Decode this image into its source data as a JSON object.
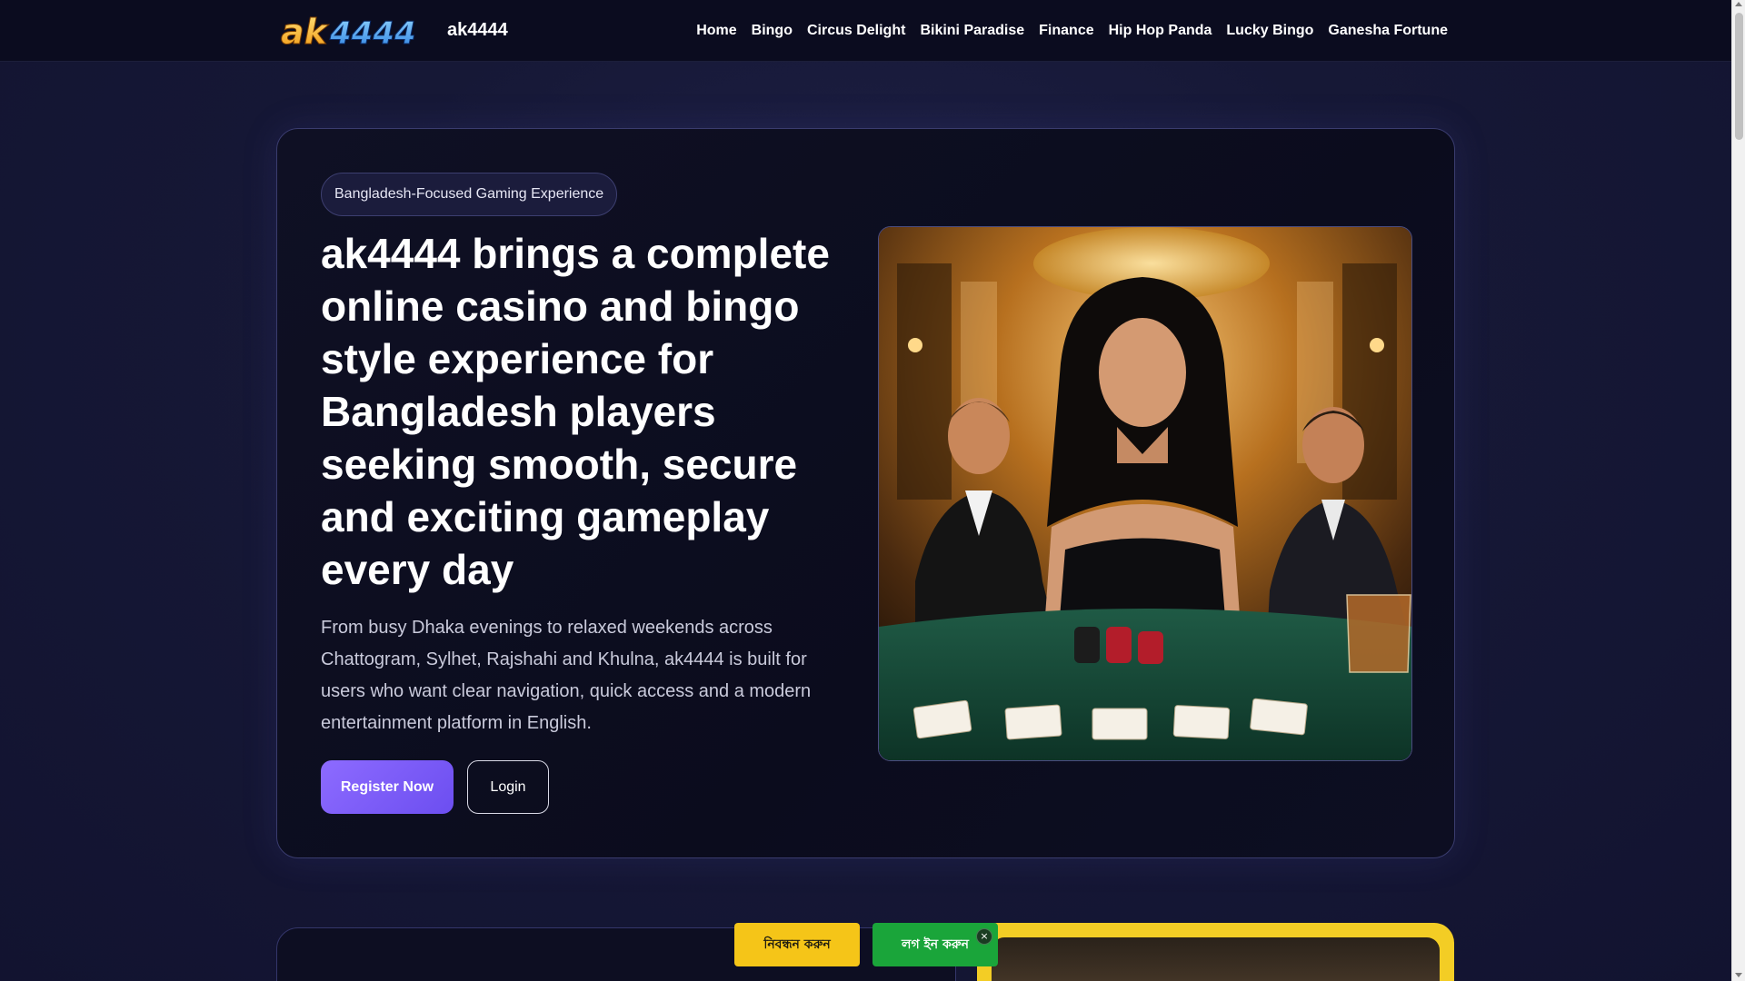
{
  "header": {
    "logo_text": "ak4444",
    "brand_name": "ak4444",
    "nav": [
      "Home",
      "Bingo",
      "Circus Delight",
      "Bikini Paradise",
      "Finance",
      "Hip Hop Panda",
      "Lucky Bingo",
      "Ganesha Fortune"
    ]
  },
  "hero": {
    "pill": "Bangladesh-Focused Gaming Experience",
    "title": "ak4444 brings a complete online casino and bingo style experience for Bangladesh players seeking smooth, secure and exciting gameplay every day",
    "description": "From busy Dhaka evenings to relaxed weekends across Chattogram, Sylhet, Rajshahi and Khulna, ak4444 is built for users who want clear navigation, quick access and a modern entertainment platform in English.",
    "register_label": "Register Now",
    "login_label": "Login"
  },
  "cta_bar": {
    "register_label": "নিবন্ধন করুন",
    "login_label": "লগ ইন করুন",
    "close_label": "×"
  },
  "colors": {
    "accent_purple": "#7c5cff",
    "cta_yellow": "#f5c518",
    "cta_green": "#1aa53a",
    "page_bg": "#161836"
  }
}
